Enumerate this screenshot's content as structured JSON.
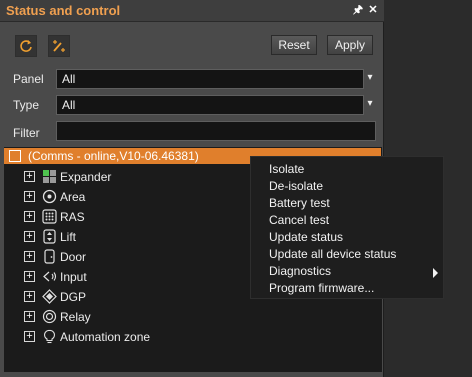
{
  "window": {
    "title": "Status and control",
    "pin_glyph": "🖈",
    "close_glyph": "✕"
  },
  "toolbar": {
    "refresh_icon": "refresh-icon",
    "magic_icon": "wand-icon",
    "reset_label": "Reset",
    "apply_label": "Apply"
  },
  "filters": {
    "panel_label": "Panel",
    "panel_value": "All",
    "type_label": "Type",
    "type_value": "All",
    "filter_label": "Filter",
    "filter_value": ""
  },
  "tree": {
    "root_label": "(Comms - online,V10-06.46381)",
    "items": [
      {
        "label": "Expander",
        "icon": "expander-icon"
      },
      {
        "label": "Area",
        "icon": "area-icon"
      },
      {
        "label": "RAS",
        "icon": "keypad-icon"
      },
      {
        "label": "Lift",
        "icon": "lift-icon"
      },
      {
        "label": "Door",
        "icon": "door-icon"
      },
      {
        "label": "Input",
        "icon": "input-icon"
      },
      {
        "label": "DGP",
        "icon": "dgp-icon"
      },
      {
        "label": "Relay",
        "icon": "relay-icon"
      },
      {
        "label": "Automation zone",
        "icon": "bulb-icon"
      }
    ]
  },
  "context_menu": {
    "items": [
      "Isolate",
      "De-isolate",
      "Battery test",
      "Cancel test",
      "Update status",
      "Update all device status",
      "Diagnostics",
      "Program firmware..."
    ]
  },
  "colors": {
    "accent": "#e07f2c",
    "title": "#f0a050",
    "panel_bg": "#4a4a4a",
    "tree_bg": "#1b1b1b"
  }
}
